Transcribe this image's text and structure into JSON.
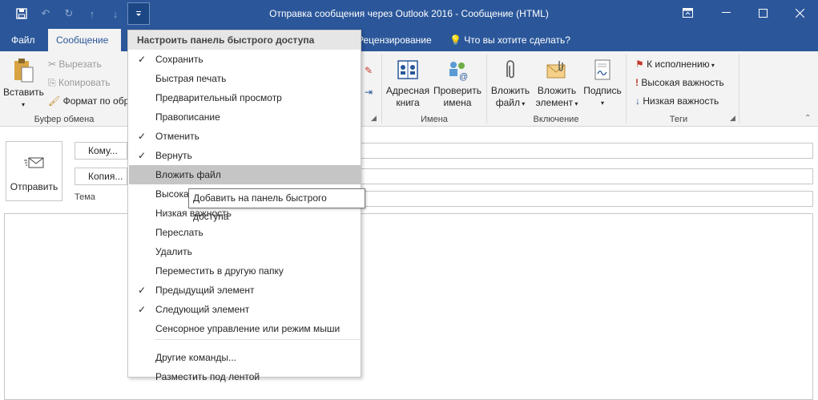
{
  "window": {
    "title": "Отправка сообщения через Outlook 2016  -  Сообщение (HTML)"
  },
  "tabs": [
    {
      "label": "Файл"
    },
    {
      "label": "Сообщение"
    },
    {
      "label": "Рецензирование"
    },
    {
      "label": "Что вы хотите сделать?"
    }
  ],
  "ribbon": {
    "clipboard": {
      "paste_label": "Вставить",
      "cut_label": "Вырезать",
      "copy_label": "Копировать",
      "format_label": "Формат по обр",
      "group_label": "Буфер обмена"
    },
    "names": {
      "address_book_label_1": "Адресная",
      "address_book_label_2": "книга",
      "check_names_label_1": "Проверить",
      "check_names_label_2": "имена",
      "group_label": "Имена"
    },
    "include": {
      "attach_file_1": "Вложить",
      "attach_file_2": "файл",
      "attach_item_1": "Вложить",
      "attach_item_2": "элемент",
      "signature_1": "Подпись",
      "group_label": "Включение"
    },
    "tags": {
      "followup_label": "К исполнению",
      "high_label": "Высокая важность",
      "low_label": "Низкая важность",
      "group_label": "Теги"
    }
  },
  "compose": {
    "send_label": "Отправить",
    "to_label": "Кому...",
    "cc_label": "Копия...",
    "subject_label": "Тема"
  },
  "menu": {
    "header": "Настроить панель быстрого доступа",
    "items": [
      {
        "label": "Сохранить",
        "checked": true
      },
      {
        "label": "Быстрая печать",
        "checked": false
      },
      {
        "label": "Предварительный просмотр",
        "checked": false
      },
      {
        "label": "Правописание",
        "checked": false
      },
      {
        "label": "Отменить",
        "checked": true
      },
      {
        "label": "Вернуть",
        "checked": true
      },
      {
        "label": "Вложить файл",
        "checked": false
      },
      {
        "label": "Высокая важность",
        "checked": false
      },
      {
        "label": "Низкая важность",
        "checked": false
      },
      {
        "label": "Переслать",
        "checked": false
      },
      {
        "label": "Удалить",
        "checked": false
      },
      {
        "label": "Переместить в другую папку",
        "checked": false
      },
      {
        "label": "Предыдущий элемент",
        "checked": true
      },
      {
        "label": "Следующий элемент",
        "checked": true
      },
      {
        "label": "Сенсорное управление или режим мыши",
        "checked": false
      },
      {
        "label": "Другие команды...",
        "checked": false
      },
      {
        "label": "Разместить под лентой",
        "checked": false
      }
    ],
    "check_glyph": "✓"
  },
  "tooltip": {
    "text": "Добавить на панель быстрого доступа"
  },
  "colors": {
    "accent": "#2b579a",
    "ribbon_bg": "#f3f3f3",
    "highlight": "#c5c5c5"
  }
}
